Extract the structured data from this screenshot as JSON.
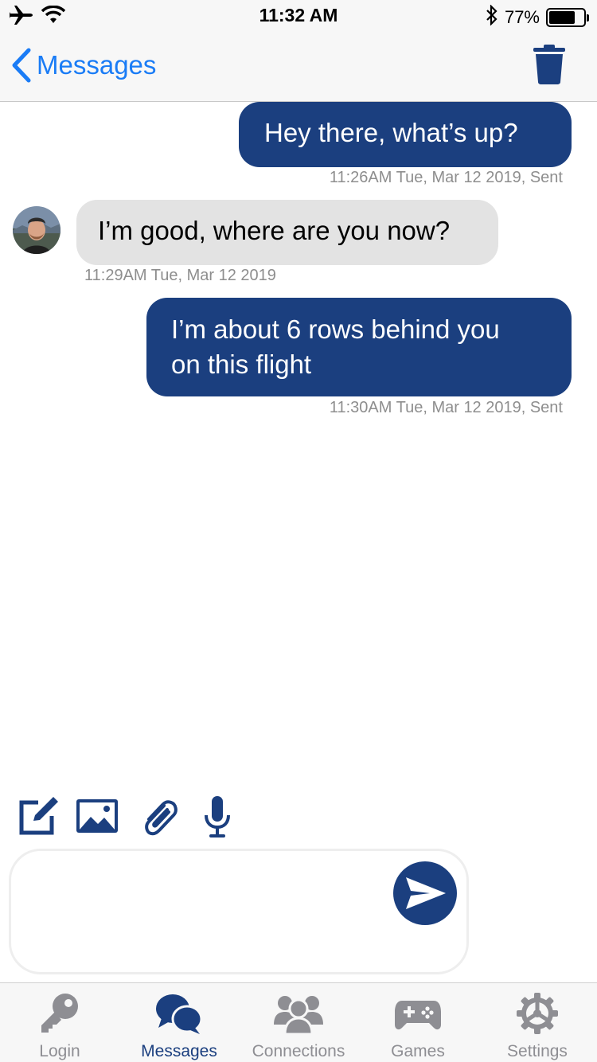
{
  "status_bar": {
    "time": "11:32 AM",
    "battery_text": "77%",
    "battery_level": 0.77,
    "icons": [
      "airplane-icon",
      "wifi-icon",
      "bluetooth-icon",
      "battery-icon"
    ]
  },
  "nav": {
    "back_label": "Messages",
    "trash_icon": "trash-icon"
  },
  "messages": [
    {
      "direction": "sent",
      "text": "Hey there, what’s up?",
      "meta": "11:26AM Tue, Mar 12 2019, Sent"
    },
    {
      "direction": "received",
      "text": "I’m good, where are you now?",
      "meta": "11:29AM Tue, Mar 12 2019"
    },
    {
      "direction": "sent",
      "text_line1": "I’m about 6 rows behind you",
      "text_line2": "on this flight",
      "meta": "11:30AM Tue, Mar 12 2019, Sent"
    }
  ],
  "composer": {
    "tools": [
      "compose-icon",
      "image-icon",
      "paperclip-icon",
      "microphone-icon"
    ],
    "input_value": "",
    "input_placeholder": "",
    "send_icon": "send-icon"
  },
  "tabs": [
    {
      "label": "Login",
      "icon": "key-icon",
      "active": false
    },
    {
      "label": "Messages",
      "icon": "chat-bubbles-icon",
      "active": true
    },
    {
      "label": "Connections",
      "icon": "people-icon",
      "active": false
    },
    {
      "label": "Games",
      "icon": "gamepad-icon",
      "active": false
    },
    {
      "label": "Settings",
      "icon": "gear-icon",
      "active": false
    }
  ],
  "colors": {
    "accent": "#1b3f7f",
    "ios_blue": "#1a7cf6",
    "received_bubble": "#e3e3e3",
    "inactive_tab": "#8e8e93",
    "meta_text": "#8e8e8e"
  }
}
